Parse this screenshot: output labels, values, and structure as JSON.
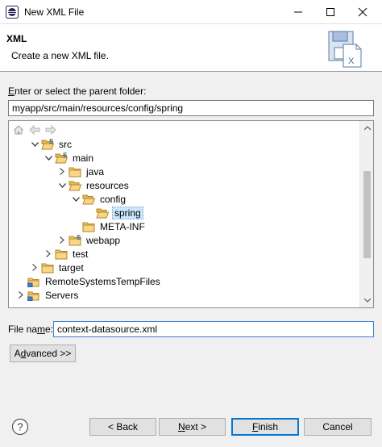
{
  "window": {
    "title": "New XML File"
  },
  "header": {
    "title": "XML",
    "description": "Create a new XML file."
  },
  "folder": {
    "label_prefix": "E",
    "label_rest": "nter or select the parent folder:",
    "value": "myapp/src/main/resources/config/spring"
  },
  "tree": {
    "items": [
      {
        "label": "src",
        "expanded": true,
        "type": "source-folder"
      },
      {
        "label": "main",
        "expanded": true,
        "type": "source-folder"
      },
      {
        "label": "java",
        "expanded": false,
        "type": "folder"
      },
      {
        "label": "resources",
        "expanded": true,
        "type": "folder"
      },
      {
        "label": "config",
        "expanded": true,
        "type": "folder"
      },
      {
        "label": "spring",
        "expanded": null,
        "type": "folder",
        "selected": true
      },
      {
        "label": "META-INF",
        "expanded": null,
        "type": "folder"
      },
      {
        "label": "webapp",
        "expanded": false,
        "type": "source-folder"
      },
      {
        "label": "test",
        "expanded": false,
        "type": "folder"
      },
      {
        "label": "target",
        "expanded": false,
        "type": "folder"
      },
      {
        "label": "RemoteSystemsTempFiles",
        "expanded": null,
        "type": "project"
      },
      {
        "label": "Servers",
        "expanded": false,
        "type": "project"
      }
    ]
  },
  "file_name": {
    "label_prefix": "File na",
    "label_u": "m",
    "label_rest": "e:",
    "value": "context-datasource.xml"
  },
  "advanced": {
    "prefix": "A",
    "u": "d",
    "rest": "vanced >>"
  },
  "buttons": {
    "back": "< Back",
    "next_u": "N",
    "next_rest": "ext >",
    "finish_u": "F",
    "finish_rest": "inish",
    "cancel": "Cancel"
  },
  "icons": {
    "app": "eclipse-icon",
    "header_graphic": "xml-file-wizard-icon",
    "help": "help-icon",
    "home": "home-icon",
    "back": "back-arrow-icon",
    "forward": "forward-arrow-icon"
  }
}
